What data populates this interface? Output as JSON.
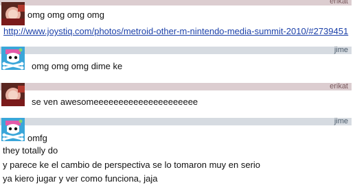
{
  "messages": [
    {
      "user": "erikat",
      "avatar_icon": "photo-avatar-icon",
      "lines": [
        "omg omg omg omg",
        "http://www.joystiq.com/photos/metroid-other-m-nintendo-media-summit-2010/#2739451"
      ]
    },
    {
      "user": "jime",
      "avatar_icon": "pirate-skull-avatar-icon",
      "lines": [
        "omg omg omg dime ke"
      ]
    },
    {
      "user": "erikat",
      "avatar_icon": "photo-avatar-icon",
      "lines": [
        "se ven awesomeeeeeeeeeeeeeeeeeeeee"
      ]
    },
    {
      "user": "jime",
      "avatar_icon": "pirate-skull-avatar-icon",
      "lines": [
        "omfg",
        "they totally do",
        "y parece ke el cambio de perspectiva se lo tomaron muy en serio",
        "ya kiero jugar y ver como funciona, jaja"
      ]
    }
  ],
  "colors": {
    "erikat_bar": "#dccdd0",
    "jime_bar": "#d6dbe1",
    "link": "#1a3fa8",
    "text": "#111111"
  }
}
